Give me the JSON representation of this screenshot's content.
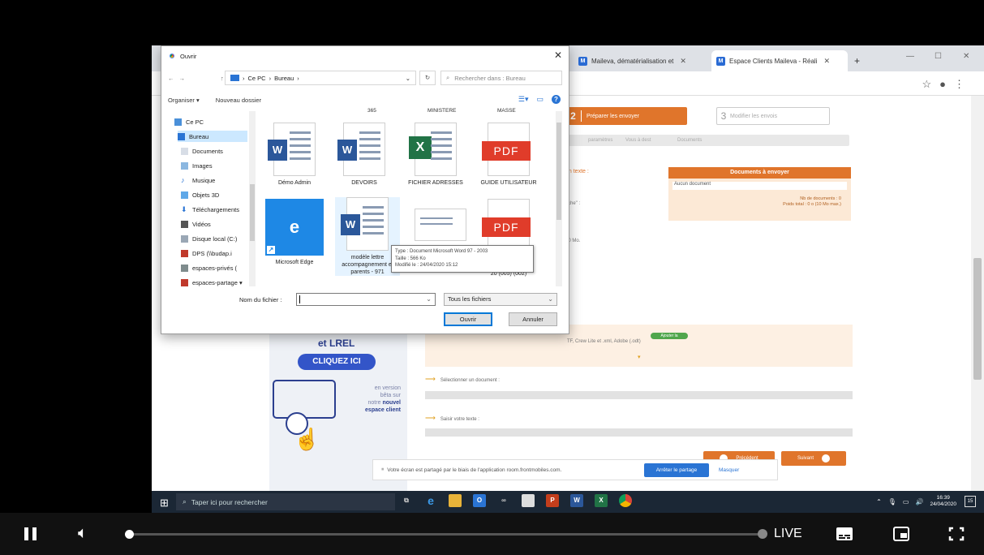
{
  "browser": {
    "tabs": [
      {
        "label": "Maileva, dématérialisation et",
        "favicon": "M"
      },
      {
        "label": "Espace Clients Maileva - Réali",
        "favicon": "M"
      }
    ],
    "tab_close": "✕",
    "new_tab": "+"
  },
  "page": {
    "step2_num": "2",
    "step2_label": "Préparer les envoyer",
    "step3_num": "3",
    "step3_label": "Modifier les envois",
    "subtabs": [
      "paramètres",
      "Vous à dest",
      "Documents"
    ],
    "add_text_link": "un texte :",
    "hint_label": "fiche\" :",
    "size_limit": "10 Mo.",
    "docs_title": "Documents à envoyer",
    "docs_empty": "Aucun document",
    "docs_count": "Nb de documents : 0",
    "docs_weight": "Poids total : 0 o (10 Mo max.)",
    "formats_note": "TF, Crew Lite et .xml, Adobe (.odt)",
    "green_pill": "Ajouter la",
    "row_select": "Sélectionner un document :",
    "row_text": "Saisir votre texte :",
    "prev_label": "Précédent",
    "next_label": "Suivant",
    "lrel": "et LREL",
    "cliquez": "CLIQUEZ ICI",
    "promo_line1": "en version",
    "promo_line2": "bêta sur",
    "promo_line3": "notre",
    "promo_bold1": "nouvel",
    "promo_bold2": "espace client",
    "share_text": "Votre écran est partagé par le biais de l'application room.frontmobiles.com.",
    "share_stop": "Arrêter le partage",
    "share_hide": "Masquer"
  },
  "dialog": {
    "title": "Ouvrir",
    "path": [
      "Ce PC",
      "Bureau"
    ],
    "search_placeholder": "Rechercher dans : Bureau",
    "organize": "Organiser ▾",
    "new_folder": "Nouveau dossier",
    "nav_items": [
      {
        "label": "Ce PC",
        "icon": "pc-icon"
      },
      {
        "label": "Bureau",
        "icon": "desktop-icon"
      },
      {
        "label": "Documents",
        "icon": "documents-icon"
      },
      {
        "label": "Images",
        "icon": "images-icon"
      },
      {
        "label": "Musique",
        "icon": "music-icon"
      },
      {
        "label": "Objets 3D",
        "icon": "objects3d-icon"
      },
      {
        "label": "Téléchargements",
        "icon": "download-icon"
      },
      {
        "label": "Vidéos",
        "icon": "video-icon"
      },
      {
        "label": "Disque local (C:)",
        "icon": "disk-icon"
      },
      {
        "label": "DPS (\\\\budap.i",
        "icon": "network-drive-icon"
      },
      {
        "label": "espaces-privés (",
        "icon": "network-drive-icon"
      },
      {
        "label": "espaces-partage ▾",
        "icon": "network-drive-icon"
      }
    ],
    "top_labels": [
      "365",
      "MINISTERE",
      "MASSE"
    ],
    "files": [
      {
        "label": "Démo Admin",
        "kind": "word"
      },
      {
        "label": "DEVOIRS",
        "kind": "word"
      },
      {
        "label": "FICHIER ADRESSES",
        "kind": "excel"
      },
      {
        "label": "GUIDE UTILISATEUR",
        "kind": "pdf"
      },
      {
        "label": "Microsoft Edge",
        "kind": "edge"
      },
      {
        "label": "modèle lettre accompagnement et parents - 971",
        "kind": "word-hover"
      },
      {
        "label": "",
        "kind": "txt"
      },
      {
        "label": "20 (005) (002)",
        "kind": "pdf"
      }
    ],
    "tooltip": {
      "type": "Type : Document Microsoft Word 97 - 2003",
      "size": "Taille : 566 Ko",
      "modified": "Modifié le : 24/04/2020 15:12"
    },
    "filename_label": "Nom du fichier :",
    "filename_value": "",
    "filetype": "Tous les fichiers",
    "open_btn": "Ouvrir",
    "cancel_btn": "Annuler"
  },
  "taskbar": {
    "search_placeholder": "Taper ici pour rechercher",
    "time": "16:39",
    "date": "24/04/2020",
    "notif_count": "15"
  },
  "player": {
    "live_label": "LIVE",
    "progress": 0.0
  },
  "colors": {
    "accent_orange": "#e0752b",
    "windows_blue": "#0078d7",
    "taskbar_bg": "#1b2735"
  }
}
